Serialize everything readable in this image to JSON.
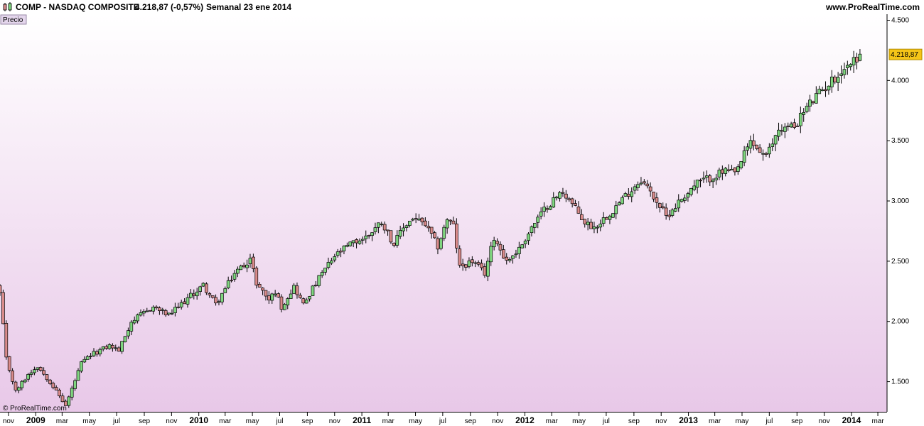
{
  "header": {
    "symbol_label": "COMP - NASDAQ COMPOSITE",
    "price_change": "4.218,87 (-0,57%)",
    "period": "Semanal  23 ene 2014",
    "site": "www.ProRealTime.com"
  },
  "panel": {
    "label": "Precio",
    "copyright": "© ProRealTime.com",
    "last_price_tag": "4.218,87"
  },
  "colors": {
    "up_candle": "#7fd67f",
    "down_candle": "#d98b8b",
    "background_top": "#ffffff",
    "background_bottom": "#e8c8e8",
    "price_tag": "#f5c518"
  },
  "chart_data": {
    "type": "candlestick",
    "interval": "weekly",
    "y_axis": {
      "ticks": [
        1500,
        2000,
        2500,
        3000,
        3500,
        4000,
        4500
      ],
      "tick_labels": [
        "1.500",
        "2.000",
        "2.500",
        "3.000",
        "3.500",
        "4.000",
        "4.500"
      ],
      "range": [
        1250,
        4550
      ]
    },
    "x_axis": {
      "range": [
        "2008-10-13",
        "2014-03-20"
      ],
      "ticks": [
        {
          "date": "2008-11-01",
          "label": "nov",
          "bold": false
        },
        {
          "date": "2009-01-01",
          "label": "2009",
          "bold": true
        },
        {
          "date": "2009-03-01",
          "label": "mar",
          "bold": false
        },
        {
          "date": "2009-05-01",
          "label": "may",
          "bold": false
        },
        {
          "date": "2009-07-01",
          "label": "jul",
          "bold": false
        },
        {
          "date": "2009-09-01",
          "label": "sep",
          "bold": false
        },
        {
          "date": "2009-11-01",
          "label": "nov",
          "bold": false
        },
        {
          "date": "2010-01-01",
          "label": "2010",
          "bold": true
        },
        {
          "date": "2010-03-01",
          "label": "mar",
          "bold": false
        },
        {
          "date": "2010-05-01",
          "label": "may",
          "bold": false
        },
        {
          "date": "2010-07-01",
          "label": "jul",
          "bold": false
        },
        {
          "date": "2010-09-01",
          "label": "sep",
          "bold": false
        },
        {
          "date": "2010-11-01",
          "label": "nov",
          "bold": false
        },
        {
          "date": "2011-01-01",
          "label": "2011",
          "bold": true
        },
        {
          "date": "2011-03-01",
          "label": "mar",
          "bold": false
        },
        {
          "date": "2011-05-01",
          "label": "may",
          "bold": false
        },
        {
          "date": "2011-07-01",
          "label": "jul",
          "bold": false
        },
        {
          "date": "2011-09-01",
          "label": "sep",
          "bold": false
        },
        {
          "date": "2011-11-01",
          "label": "nov",
          "bold": false
        },
        {
          "date": "2012-01-01",
          "label": "2012",
          "bold": true
        },
        {
          "date": "2012-03-01",
          "label": "mar",
          "bold": false
        },
        {
          "date": "2012-05-01",
          "label": "may",
          "bold": false
        },
        {
          "date": "2012-07-01",
          "label": "jul",
          "bold": false
        },
        {
          "date": "2012-09-01",
          "label": "sep",
          "bold": false
        },
        {
          "date": "2012-11-01",
          "label": "nov",
          "bold": false
        },
        {
          "date": "2013-01-01",
          "label": "2013",
          "bold": true
        },
        {
          "date": "2013-03-01",
          "label": "mar",
          "bold": false
        },
        {
          "date": "2013-05-01",
          "label": "may",
          "bold": false
        },
        {
          "date": "2013-07-01",
          "label": "jul",
          "bold": false
        },
        {
          "date": "2013-09-01",
          "label": "sep",
          "bold": false
        },
        {
          "date": "2013-11-01",
          "label": "nov",
          "bold": false
        },
        {
          "date": "2014-01-01",
          "label": "2014",
          "bold": true
        },
        {
          "date": "2014-03-01",
          "label": "mar",
          "bold": false
        }
      ]
    },
    "last_price": 4218.87,
    "anchors": [
      [
        "2008-10-13",
        2230
      ],
      [
        "2008-10-27",
        1690
      ],
      [
        "2008-11-17",
        1420
      ],
      [
        "2008-12-15",
        1560
      ],
      [
        "2009-01-05",
        1630
      ],
      [
        "2009-02-02",
        1500
      ],
      [
        "2009-03-09",
        1300
      ],
      [
        "2009-04-13",
        1650
      ],
      [
        "2009-05-04",
        1720
      ],
      [
        "2009-06-15",
        1800
      ],
      [
        "2009-07-06",
        1760
      ],
      [
        "2009-08-03",
        2000
      ],
      [
        "2009-09-21",
        2120
      ],
      [
        "2009-10-26",
        2050
      ],
      [
        "2009-12-07",
        2190
      ],
      [
        "2010-01-11",
        2300
      ],
      [
        "2010-02-08",
        2140
      ],
      [
        "2010-03-22",
        2400
      ],
      [
        "2010-04-26",
        2520
      ],
      [
        "2010-05-10",
        2320
      ],
      [
        "2010-06-07",
        2180
      ],
      [
        "2010-06-21",
        2250
      ],
      [
        "2010-07-05",
        2120
      ],
      [
        "2010-08-02",
        2290
      ],
      [
        "2010-08-23",
        2140
      ],
      [
        "2010-09-06",
        2230
      ],
      [
        "2010-10-04",
        2400
      ],
      [
        "2010-11-01",
        2540
      ],
      [
        "2010-12-06",
        2640
      ],
      [
        "2011-01-10",
        2700
      ],
      [
        "2011-02-14",
        2830
      ],
      [
        "2011-03-14",
        2640
      ],
      [
        "2011-04-04",
        2780
      ],
      [
        "2011-04-25",
        2860
      ],
      [
        "2011-05-23",
        2800
      ],
      [
        "2011-06-20",
        2620
      ],
      [
        "2011-07-11",
        2850
      ],
      [
        "2011-07-25",
        2790
      ],
      [
        "2011-08-08",
        2450
      ],
      [
        "2011-09-05",
        2500
      ],
      [
        "2011-10-03",
        2400
      ],
      [
        "2011-10-24",
        2700
      ],
      [
        "2011-11-21",
        2500
      ],
      [
        "2011-12-19",
        2600
      ],
      [
        "2012-01-16",
        2780
      ],
      [
        "2012-02-20",
        2960
      ],
      [
        "2012-03-26",
        3080
      ],
      [
        "2012-04-09",
        3010
      ],
      [
        "2012-05-14",
        2820
      ],
      [
        "2012-06-04",
        2780
      ],
      [
        "2012-07-09",
        2900
      ],
      [
        "2012-08-20",
        3070
      ],
      [
        "2012-09-17",
        3180
      ],
      [
        "2012-10-22",
        3000
      ],
      [
        "2012-11-12",
        2870
      ],
      [
        "2012-12-17",
        3020
      ],
      [
        "2013-01-21",
        3150
      ],
      [
        "2013-02-18",
        3190
      ],
      [
        "2013-03-25",
        3250
      ],
      [
        "2013-04-15",
        3220
      ],
      [
        "2013-05-20",
        3490
      ],
      [
        "2013-06-24",
        3360
      ],
      [
        "2013-07-22",
        3600
      ],
      [
        "2013-08-26",
        3620
      ],
      [
        "2013-09-23",
        3780
      ],
      [
        "2013-10-28",
        3920
      ],
      [
        "2013-12-02",
        4050
      ],
      [
        "2014-01-20",
        4218.87
      ]
    ]
  }
}
